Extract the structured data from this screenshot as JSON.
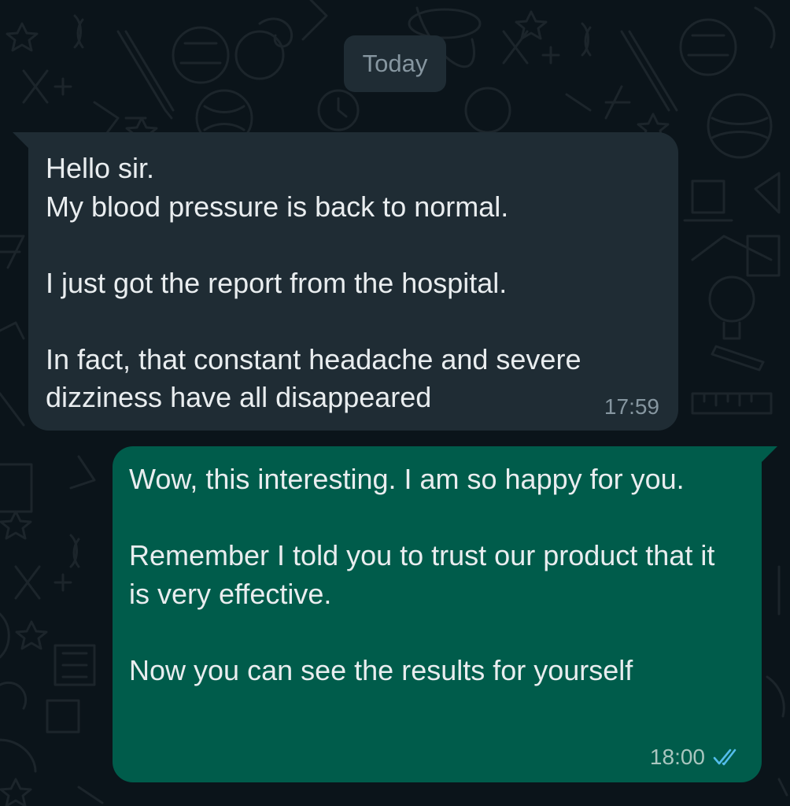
{
  "date_separator": "Today",
  "messages": [
    {
      "direction": "incoming",
      "text": "Hello sir.\nMy blood pressure is back to normal.\n\nI just got the report from the hospital.\n\nIn fact, that constant headache and severe dizziness have all disappeared",
      "time": "17:59"
    },
    {
      "direction": "outgoing",
      "text": "Wow, this interesting. I am so happy for you.\n\nRemember I told you to trust our product that it is very effective.\n\nNow you can see the results for yourself",
      "time": "18:00",
      "status_icon": "double-check-read-icon"
    }
  ],
  "colors": {
    "background": "#0b141a",
    "incoming_bubble": "#1f2c34",
    "outgoing_bubble": "#005c4b",
    "read_ticks": "#53bdeb"
  }
}
